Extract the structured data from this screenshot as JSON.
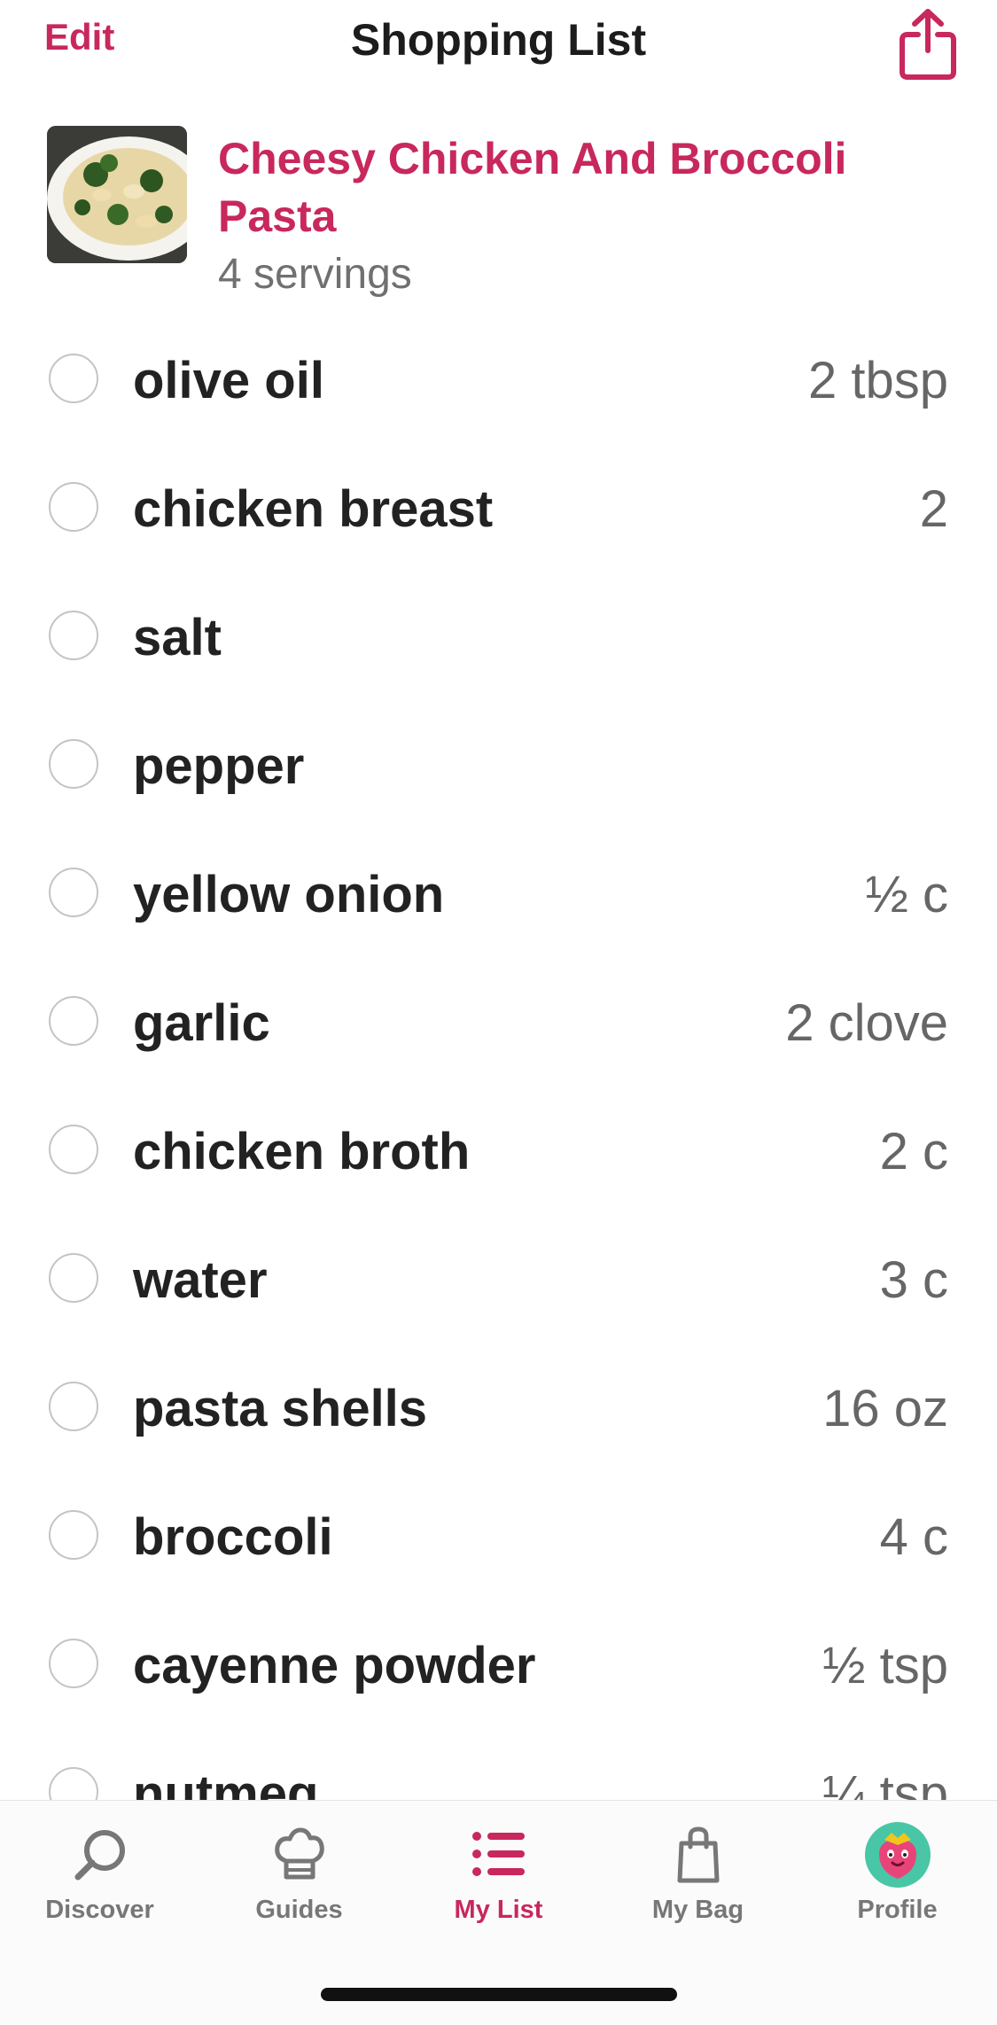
{
  "nav": {
    "edit_label": "Edit",
    "title": "Shopping List",
    "share_icon": "share-icon"
  },
  "recipe": {
    "title": "Cheesy Chicken And Broccoli Pasta",
    "servings": "4 servings",
    "image": "pasta-thumbnail"
  },
  "items": [
    {
      "name": "olive oil",
      "qty": "2 tbsp"
    },
    {
      "name": "chicken breast",
      "qty": "2"
    },
    {
      "name": "salt",
      "qty": ""
    },
    {
      "name": "pepper",
      "qty": ""
    },
    {
      "name": "yellow onion",
      "qty": "½ c"
    },
    {
      "name": "garlic",
      "qty": "2 clove"
    },
    {
      "name": "chicken broth",
      "qty": "2 c"
    },
    {
      "name": "water",
      "qty": "3 c"
    },
    {
      "name": "pasta shells",
      "qty": "16 oz"
    },
    {
      "name": "broccoli",
      "qty": "4 c"
    },
    {
      "name": "cayenne powder",
      "qty": "½ tsp"
    },
    {
      "name": "nutmeg",
      "qty": "¼ tsp"
    }
  ],
  "tabs": [
    {
      "label": "Discover",
      "icon": "search-icon",
      "active": false
    },
    {
      "label": "Guides",
      "icon": "chef-hat-icon",
      "active": false
    },
    {
      "label": "My List",
      "icon": "list-icon",
      "active": true
    },
    {
      "label": "My Bag",
      "icon": "bag-icon",
      "active": false
    },
    {
      "label": "Profile",
      "icon": "strawberry-avatar-icon",
      "active": false
    }
  ],
  "colors": {
    "accent": "#c8285c",
    "text": "#222222",
    "muted": "#666666",
    "check_border": "#c4c4c4"
  }
}
